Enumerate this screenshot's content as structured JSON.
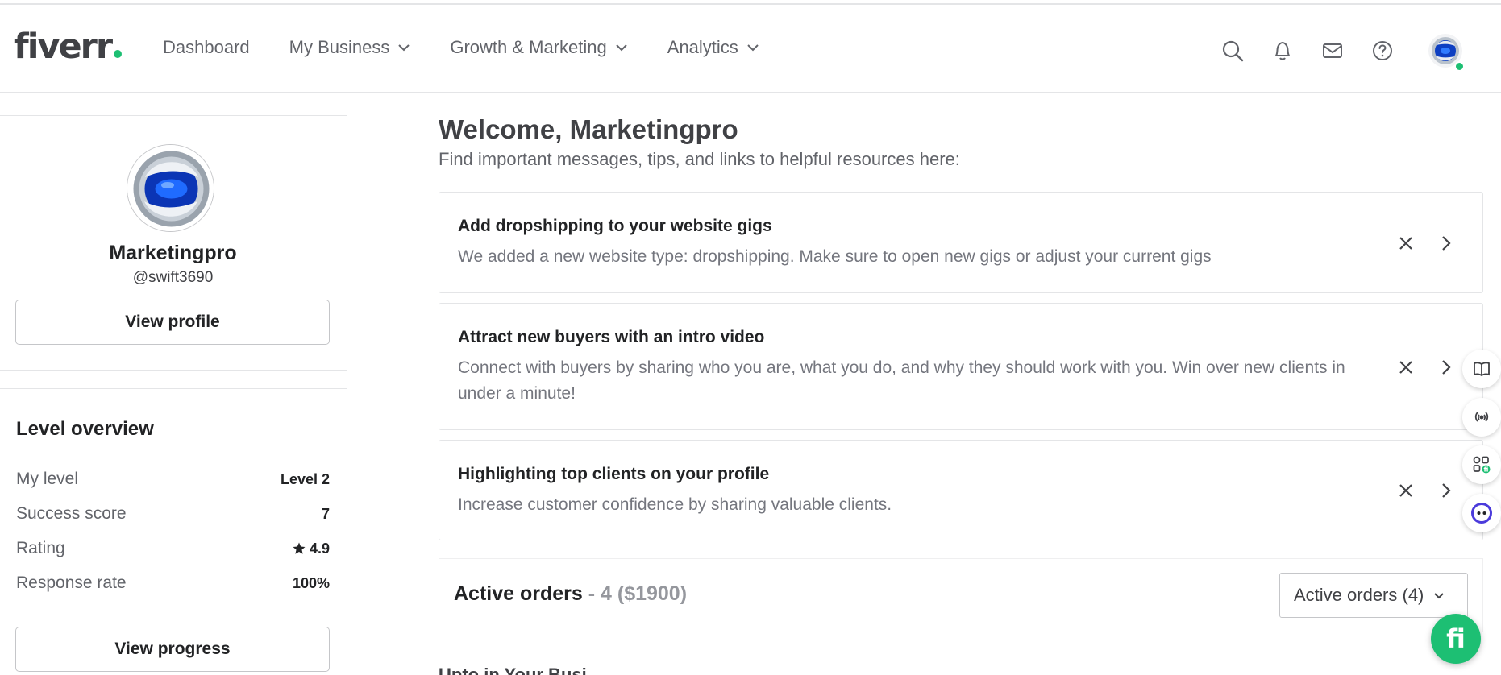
{
  "brand": {
    "logo_text": "fiverr",
    "accent": "#1dbf73"
  },
  "nav": {
    "items": [
      {
        "label": "Dashboard",
        "has_dropdown": false
      },
      {
        "label": "My Business",
        "has_dropdown": true
      },
      {
        "label": "Growth & Marketing",
        "has_dropdown": true
      },
      {
        "label": "Analytics",
        "has_dropdown": true
      }
    ]
  },
  "header_icons": [
    "search-icon",
    "bell-icon",
    "mail-icon",
    "help-icon"
  ],
  "profile": {
    "name": "Marketingpro",
    "handle": "@swift3690",
    "view_profile_label": "View profile"
  },
  "level_overview": {
    "title": "Level overview",
    "rows": [
      {
        "label": "My level",
        "value": "Level 2"
      },
      {
        "label": "Success score",
        "value": "7"
      },
      {
        "label": "Rating",
        "value": "4.9"
      },
      {
        "label": "Response rate",
        "value": "100%"
      }
    ],
    "view_progress_label": "View progress"
  },
  "main": {
    "welcome_title": "Welcome, Marketingpro",
    "welcome_sub": "Find important messages, tips, and links to helpful resources here:",
    "messages": [
      {
        "title": "Add dropshipping to your website gigs",
        "body": "We added a new website type: dropshipping. Make sure to open new gigs or adjust your current gigs"
      },
      {
        "title": "Attract new buyers with an intro video",
        "body": "Connect with buyers by sharing who you are, what you do, and why they should work with you. Win over new clients in under a minute!"
      },
      {
        "title": "Highlighting top clients on your profile",
        "body": "Increase customer confidence by sharing valuable clients."
      }
    ],
    "orders": {
      "title": "Active orders",
      "summary": " - 4 ($1900)",
      "select_value": "Active orders (4)"
    },
    "next_section_partial": "Upto in Your Busi"
  },
  "side_widgets": [
    "book-icon",
    "broadcast-icon",
    "apps-icon",
    "bot-icon"
  ],
  "chat_fab_icon": "fiverr-chat-icon"
}
